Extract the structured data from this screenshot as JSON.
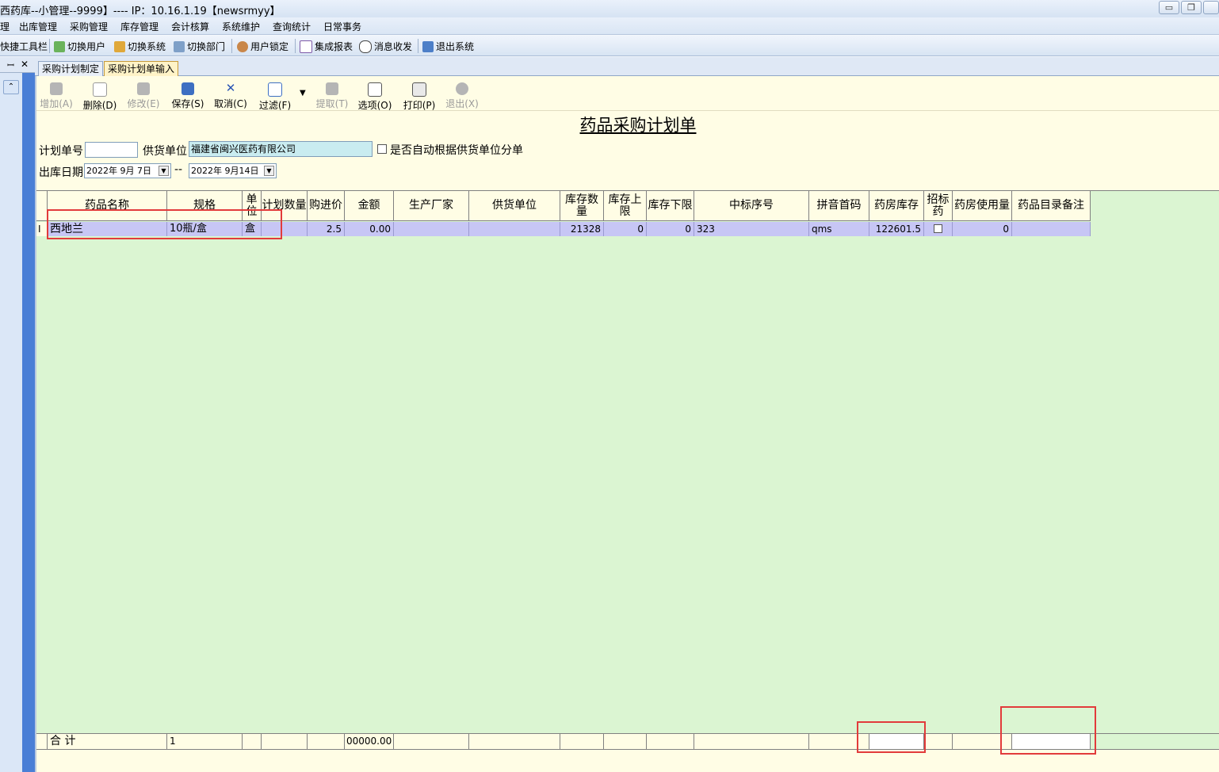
{
  "window": {
    "title": "西药库--小管理--9999】---- IP：10.16.1.19【newsrmyy】",
    "min": "▭",
    "max": "❐",
    "close": "✕"
  },
  "menu": [
    "理",
    "出库管理",
    "采购管理",
    "库存管理",
    "会计核算",
    "系统维护",
    "查询统计",
    "日常事务"
  ],
  "quick_toolbar": [
    "快捷工具栏",
    "切换用户",
    "切换系统",
    "切换部门",
    "用户锁定",
    "集成报表",
    "消息收发",
    "退出系统"
  ],
  "left_panel": {
    "pin": "ꟷ",
    "close": "✕",
    "collapse": "⌃"
  },
  "tabs": [
    "采购计划制定",
    "采购计划单输入"
  ],
  "toolbar": {
    "add": "增加(A)",
    "delete": "删除(D)",
    "modify": "修改(E)",
    "save": "保存(S)",
    "cancel": "取消(C)",
    "filter": "过滤(F)",
    "extract": "提取(T)",
    "options": "选项(O)",
    "print": "打印(P)",
    "exit": "退出(X)"
  },
  "form": {
    "title": "药品采购计划单",
    "plan_no_label": "计划单号",
    "plan_no": "",
    "supplier_label": "供货单位",
    "supplier": "福建省闽兴医药有限公司",
    "auto_split_label": "是否自动根据供货单位分单",
    "date_label": "出库日期",
    "date_from": "2022年 9月 7日",
    "date_sep": "--",
    "date_to": "2022年 9月14日"
  },
  "grid": {
    "columns": [
      "药品名称",
      "规格",
      "单位",
      "计划数量",
      "购进价",
      "金额",
      "生产厂家",
      "供货单位",
      "库存数量",
      "库存上限",
      "库存下限",
      "中标序号",
      "拼音首码",
      "药房库存",
      "招标药",
      "药房使用量",
      "药品目录备注"
    ],
    "rows": [
      {
        "indicator": "I",
        "name": "西地兰",
        "spec": "10瓶/盒",
        "unit": "盒",
        "plan_qty": "",
        "price": "2.5",
        "amount": "0.00",
        "manufacturer": "",
        "supplier": "",
        "stock": "21328",
        "upper": "0",
        "lower": "0",
        "bid_no": "323",
        "pinyin": "qms",
        "pharmacy_stock": "122601.5",
        "bid_drug": false,
        "pharmacy_usage": "0",
        "remark": ""
      }
    ],
    "footer": {
      "label": "合  计",
      "count": "1",
      "amount": "00000.00"
    }
  }
}
